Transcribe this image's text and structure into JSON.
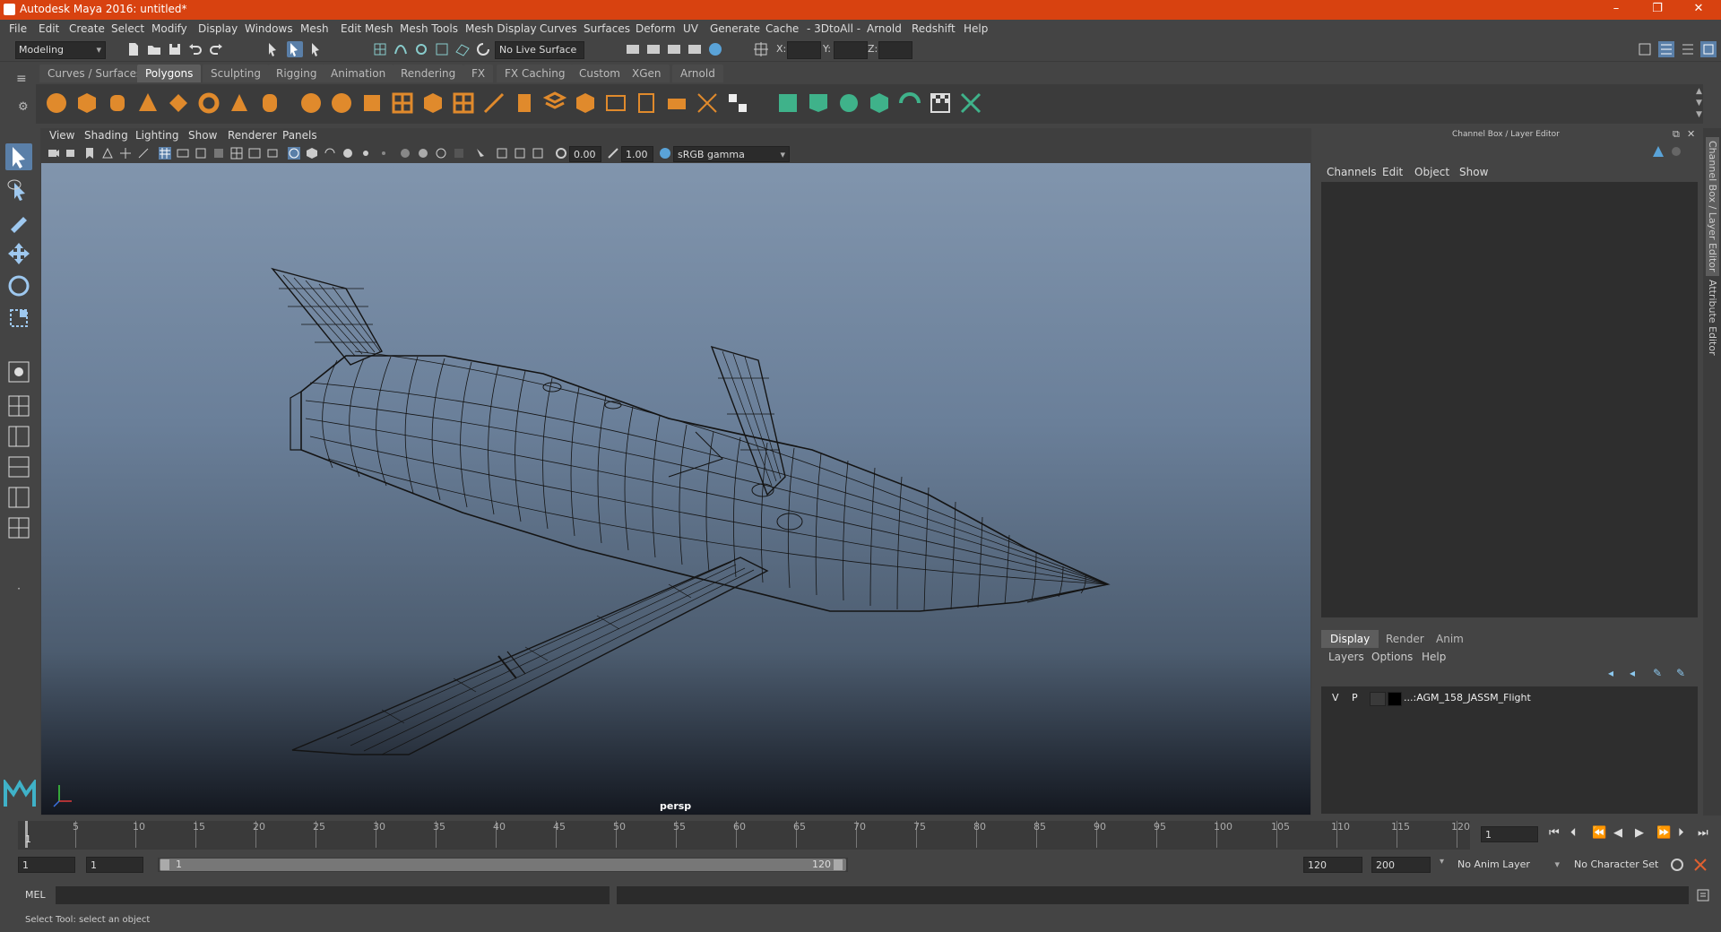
{
  "app": {
    "title": "Autodesk Maya 2016: untitled*"
  },
  "window_controls": {
    "minimize": "–",
    "restore": "❐",
    "close": "✕"
  },
  "menus": [
    "File",
    "Edit",
    "Create",
    "Select",
    "Modify",
    "Display",
    "Windows",
    "Mesh",
    "Edit Mesh",
    "Mesh Tools",
    "Mesh Display",
    "Curves",
    "Surfaces",
    "Deform",
    "UV",
    "Generate",
    "Cache",
    "- 3DtoAll -",
    "Arnold",
    "Redshift",
    "Help"
  ],
  "status_line": {
    "mode": "Modeling",
    "live_surface": "No Live Surface",
    "x_label": "X:",
    "y_label": "Y:",
    "z_label": "Z:"
  },
  "shelf_tabs": [
    {
      "label": "Curves / Surfaces",
      "active": false
    },
    {
      "label": "Polygons",
      "active": true
    },
    {
      "label": "Sculpting",
      "active": false
    },
    {
      "label": "Rigging",
      "active": false
    },
    {
      "label": "Animation",
      "active": false
    },
    {
      "label": "Rendering",
      "active": false
    },
    {
      "label": "FX",
      "active": false
    },
    {
      "label": "FX Caching",
      "active": false
    },
    {
      "label": "Custom",
      "active": false
    },
    {
      "label": "XGen",
      "active": false
    },
    {
      "label": "Arnold",
      "active": false
    }
  ],
  "viewport": {
    "menus": [
      "View",
      "Shading",
      "Lighting",
      "Show",
      "Renderer",
      "Panels"
    ],
    "exposure": "0.00",
    "gamma": "1.00",
    "color_space": "sRGB gamma",
    "camera_label": "persp"
  },
  "channel_box": {
    "title": "Channel Box / Layer Editor",
    "menus": [
      "Channels",
      "Edit",
      "Object",
      "Show"
    ]
  },
  "layer_editor": {
    "tabs": [
      {
        "label": "Display",
        "active": true
      },
      {
        "label": "Render",
        "active": false
      },
      {
        "label": "Anim",
        "active": false
      }
    ],
    "menus": [
      "Layers",
      "Options",
      "Help"
    ],
    "layers": [
      {
        "visible": "V",
        "playback": "P",
        "name": "...:AGM_158_JASSM_Flight"
      }
    ]
  },
  "side_tabs": [
    "Channel Box / Layer Editor",
    "Attribute Editor"
  ],
  "timeline": {
    "tick_labels": [
      "5",
      "10",
      "15",
      "20",
      "25",
      "30",
      "35",
      "40",
      "45",
      "50",
      "55",
      "60",
      "65",
      "70",
      "75",
      "80",
      "85",
      "90",
      "95",
      "100",
      "105",
      "110",
      "115",
      "120"
    ],
    "current_frame_marker": "1",
    "current_frame_field": "1"
  },
  "range": {
    "start_time": "1",
    "playback_start": "1",
    "slider_start": "1",
    "slider_end": "120",
    "playback_end": "120",
    "end_time": "200",
    "anim_layer": "No Anim Layer",
    "character_set": "No Character Set"
  },
  "command_line": {
    "label": "MEL"
  },
  "help_line": {
    "text": "Select Tool: select an object"
  },
  "colors": {
    "title_bar": "#d84210",
    "shelf_icon_orange": "#e08a2c",
    "shelf_icon_green": "#3fb28a",
    "accent_blue": "#5aa3d8"
  }
}
